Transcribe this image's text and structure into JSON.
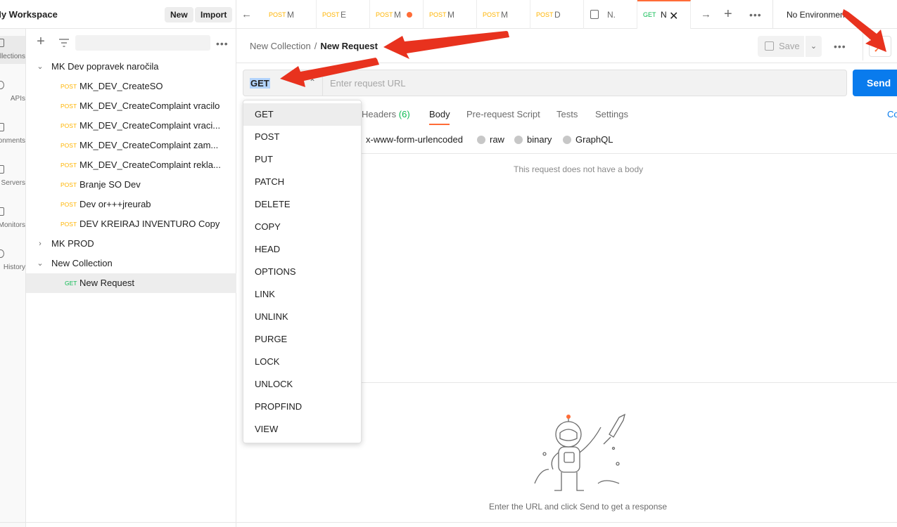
{
  "header": {
    "workspace_title": "My Workspace",
    "new_label": "New",
    "import_label": "Import"
  },
  "rail": {
    "items": [
      {
        "label": "Collections",
        "icon": "collections-icon",
        "active": true
      },
      {
        "label": "APIs",
        "icon": "apis-icon"
      },
      {
        "label": "Environments",
        "icon": "environments-icon"
      },
      {
        "label": "Mock Servers",
        "icon": "mock-servers-icon"
      },
      {
        "label": "Monitors",
        "icon": "monitors-icon"
      },
      {
        "label": "History",
        "icon": "history-icon"
      }
    ]
  },
  "sidebar": {
    "folders": [
      {
        "name": "MK Dev popravek naročila",
        "expanded": true,
        "requests": [
          {
            "method": "POST",
            "name": "MK_DEV_CreateSO"
          },
          {
            "method": "POST",
            "name": "MK_DEV_CreateComplaint vracilo"
          },
          {
            "method": "POST",
            "name": "MK_DEV_CreateComplaint vraci..."
          },
          {
            "method": "POST",
            "name": "MK_DEV_CreateComplaint zam..."
          },
          {
            "method": "POST",
            "name": "MK_DEV_CreateComplaint rekla..."
          },
          {
            "method": "POST",
            "name": "Branje SO Dev"
          },
          {
            "method": "POST",
            "name": "Dev or+++jreurab"
          },
          {
            "method": "POST",
            "name": "DEV KREIRAJ INVENTURO Copy"
          }
        ]
      },
      {
        "name": "MK PROD",
        "expanded": false,
        "requests": []
      },
      {
        "name": "New Collection",
        "expanded": true,
        "requests": [
          {
            "method": "GET",
            "name": "New Request",
            "selected": true
          }
        ]
      }
    ]
  },
  "tabs": [
    {
      "method": "POST",
      "name": "M"
    },
    {
      "method": "POST",
      "name": "E"
    },
    {
      "method": "POST",
      "name": "M",
      "unsaved": true
    },
    {
      "method": "POST",
      "name": "M"
    },
    {
      "method": "POST",
      "name": "M"
    },
    {
      "method": "POST",
      "name": "D"
    },
    {
      "method": "",
      "name": "N.",
      "icon": "document-icon"
    },
    {
      "method": "GET",
      "name": "N",
      "active": true
    }
  ],
  "environment": {
    "label": "No Environment"
  },
  "breadcrumb": {
    "collection": "New Collection",
    "separator": "/",
    "request": "New Request"
  },
  "toolbar": {
    "save_label": "Save"
  },
  "request": {
    "method": "GET",
    "url_placeholder": "Enter request URL",
    "send_label": "Send"
  },
  "request_tabs": {
    "headers_label": "Headers",
    "headers_count": "(6)",
    "body_label": "Body",
    "prerequest_label": "Pre-request Script",
    "tests_label": "Tests",
    "settings_label": "Settings",
    "cookies_label": "Co"
  },
  "body_types": {
    "urlencoded": "x-www-form-urlencoded",
    "raw": "raw",
    "binary": "binary",
    "graphql": "GraphQL"
  },
  "body_empty": "This request does not have a body",
  "response_hint": "Enter the URL and click Send to get a response",
  "methods_dropdown": [
    "GET",
    "POST",
    "PUT",
    "PATCH",
    "DELETE",
    "COPY",
    "HEAD",
    "OPTIONS",
    "LINK",
    "UNLINK",
    "PURGE",
    "LOCK",
    "UNLOCK",
    "PROPFIND",
    "VIEW"
  ],
  "colors": {
    "accent": "#ff6c37",
    "send": "#097bed",
    "post": "#ffb400",
    "get": "#0cbb52",
    "annotation": "#e8321e"
  }
}
